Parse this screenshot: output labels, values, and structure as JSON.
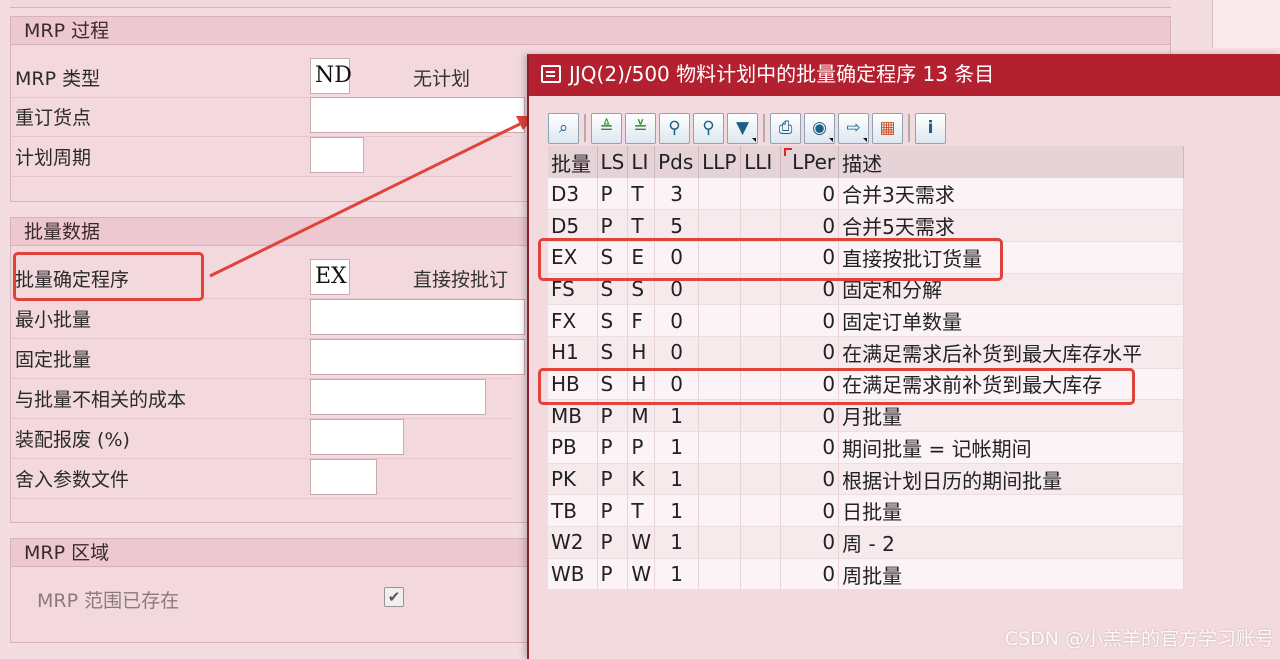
{
  "mrp_process": {
    "title": "MRP 过程",
    "mrp_type_label": "MRP 类型",
    "mrp_type_value": "ND",
    "mrp_type_desc": "无计划",
    "reorder_point_label": "重订货点",
    "reorder_point_value": "",
    "planning_cycle_label": "计划周期",
    "planning_cycle_value": ""
  },
  "lot_size_data": {
    "title": "批量数据",
    "lot_procedure_label": "批量确定程序",
    "lot_procedure_value": "EX",
    "lot_procedure_desc": "直接按批订",
    "min_lot_label": "最小批量",
    "min_lot_value": "",
    "fixed_lot_label": "固定批量",
    "fixed_lot_value": "",
    "independent_cost_label": "与批量不相关的成本",
    "independent_cost_value": "",
    "assembly_scrap_label": "装配报废 (%)",
    "assembly_scrap_value": "",
    "rounding_profile_label": "舍入参数文件",
    "rounding_profile_value": ""
  },
  "mrp_area": {
    "title": "MRP 区域",
    "exists_label": "MRP 范围已存在",
    "exists_checked": true,
    "check_glyph": "✔"
  },
  "popup": {
    "title": "JJQ(2)/500 物料计划中的批量确定程序 13 条目",
    "toolbar": [
      {
        "icon": "find-icon",
        "glyph": "⌕"
      },
      {
        "icon": "sort-ascending-icon",
        "glyph": "≜"
      },
      {
        "icon": "sort-descending-icon",
        "glyph": "≚"
      },
      {
        "icon": "binoculars-icon",
        "glyph": "⚲"
      },
      {
        "icon": "find-next-icon",
        "glyph": "⚲"
      },
      {
        "icon": "filter-icon",
        "glyph": "▼"
      },
      {
        "icon": "print-icon",
        "glyph": "⎙"
      },
      {
        "icon": "view-icon",
        "glyph": "◉"
      },
      {
        "icon": "export-icon",
        "glyph": "⇨"
      },
      {
        "icon": "layout-grid-icon",
        "glyph": "▦"
      },
      {
        "icon": "info-icon",
        "glyph": "i"
      }
    ],
    "columns": [
      "批量",
      "LS",
      "LI",
      "Pds",
      "LLP",
      "LLI",
      "LPer",
      "描述"
    ],
    "rows": [
      {
        "lot": "D3",
        "ls": "P",
        "li": "T",
        "pds": "3",
        "llp": "",
        "lli": "",
        "lper": "0",
        "desc": "合并3天需求"
      },
      {
        "lot": "D5",
        "ls": "P",
        "li": "T",
        "pds": "5",
        "llp": "",
        "lli": "",
        "lper": "0",
        "desc": "合并5天需求"
      },
      {
        "lot": "EX",
        "ls": "S",
        "li": "E",
        "pds": "0",
        "llp": "",
        "lli": "",
        "lper": "0",
        "desc": "直接按批订货量"
      },
      {
        "lot": "FS",
        "ls": "S",
        "li": "S",
        "pds": "0",
        "llp": "",
        "lli": "",
        "lper": "0",
        "desc": "固定和分解"
      },
      {
        "lot": "FX",
        "ls": "S",
        "li": "F",
        "pds": "0",
        "llp": "",
        "lli": "",
        "lper": "0",
        "desc": "固定订单数量"
      },
      {
        "lot": "H1",
        "ls": "S",
        "li": "H",
        "pds": "0",
        "llp": "",
        "lli": "",
        "lper": "0",
        "desc": "在满足需求后补货到最大库存水平"
      },
      {
        "lot": "HB",
        "ls": "S",
        "li": "H",
        "pds": "0",
        "llp": "",
        "lli": "",
        "lper": "0",
        "desc": "在满足需求前补货到最大库存"
      },
      {
        "lot": "MB",
        "ls": "P",
        "li": "M",
        "pds": "1",
        "llp": "",
        "lli": "",
        "lper": "0",
        "desc": "月批量"
      },
      {
        "lot": "PB",
        "ls": "P",
        "li": "P",
        "pds": "1",
        "llp": "",
        "lli": "",
        "lper": "0",
        "desc": "期间批量 = 记帐期间"
      },
      {
        "lot": "PK",
        "ls": "P",
        "li": "K",
        "pds": "1",
        "llp": "",
        "lli": "",
        "lper": "0",
        "desc": "根据计划日历的期间批量"
      },
      {
        "lot": "TB",
        "ls": "P",
        "li": "T",
        "pds": "1",
        "llp": "",
        "lli": "",
        "lper": "0",
        "desc": "日批量"
      },
      {
        "lot": "W2",
        "ls": "P",
        "li": "W",
        "pds": "1",
        "llp": "",
        "lli": "",
        "lper": "0",
        "desc": "周 - 2"
      },
      {
        "lot": "WB",
        "ls": "P",
        "li": "W",
        "pds": "1",
        "llp": "",
        "lli": "",
        "lper": "0",
        "desc": "周批量"
      }
    ]
  },
  "watermark": "CSDN @小羔羊的官方学习账号",
  "colors": {
    "title_bar": "#b3202f",
    "highlight": "#e0433a",
    "background": "#f4dde2"
  }
}
